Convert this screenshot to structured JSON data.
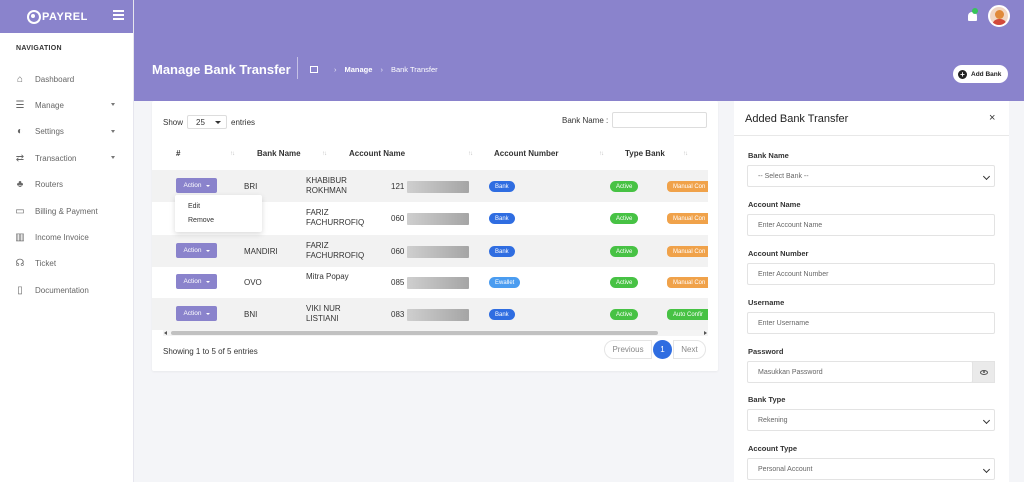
{
  "brand": {
    "name": "PAYREL"
  },
  "sidebar": {
    "title": "NAVIGATION",
    "items": [
      {
        "label": "Dashboard",
        "icon": "home-icon",
        "glyph": "⌂",
        "has_caret": false
      },
      {
        "label": "Manage",
        "icon": "list-icon",
        "glyph": "☰",
        "has_caret": true
      },
      {
        "label": "Settings",
        "icon": "toggle-icon",
        "glyph": "◐",
        "has_caret": true
      },
      {
        "label": "Transaction",
        "icon": "exchange-icon",
        "glyph": "⇄",
        "has_caret": true
      },
      {
        "label": "Routers",
        "icon": "sitemap-icon",
        "glyph": "♣",
        "has_caret": false
      },
      {
        "label": "Billing & Payment",
        "icon": "credit-card-icon",
        "glyph": "▭",
        "has_caret": false
      },
      {
        "label": "Income Invoice",
        "icon": "bar-chart-icon",
        "glyph": "▥",
        "has_caret": false
      },
      {
        "label": "Ticket",
        "icon": "headset-icon",
        "glyph": "☊",
        "has_caret": false
      },
      {
        "label": "Documentation",
        "icon": "document-icon",
        "glyph": "▯",
        "has_caret": false
      }
    ]
  },
  "header": {
    "page_title": "Manage Bank Transfer",
    "breadcrumb": [
      "Manage",
      "Bank Transfer"
    ],
    "add_button": "Add Bank"
  },
  "table": {
    "show_label": "Show",
    "entries_value": "25",
    "entries_label": "entries",
    "search_label": "Bank Name :",
    "columns": [
      "#",
      "Bank Name",
      "Account Name",
      "Account Number",
      "Type Bank"
    ],
    "action_label": "Action",
    "rows": [
      {
        "bank": "BRI",
        "name": "KHABIBUR ROKHMAN",
        "number": "121",
        "type": "Bank",
        "status": "Active",
        "mode": "Manual Con"
      },
      {
        "bank": "",
        "name": "FARIZ FACHURROFIQ",
        "number": "060",
        "type": "Bank",
        "status": "Active",
        "mode": "Manual Con"
      },
      {
        "bank": "MANDIRI",
        "name": "FARIZ FACHURROFIQ",
        "number": "060",
        "type": "Bank",
        "status": "Active",
        "mode": "Manual Con"
      },
      {
        "bank": "OVO",
        "name": "Mitra Popay",
        "number": "085",
        "type": "Ewallet",
        "status": "Active",
        "mode": "Manual Con"
      },
      {
        "bank": "BNI",
        "name": "VIKI NUR LISTIANI",
        "number": "083",
        "type": "Bank",
        "status": "Active",
        "mode": "Auto Confir"
      }
    ],
    "dropdown": [
      "Edit",
      "Remove"
    ],
    "footer": "Showing 1 to 5 of 5 entries",
    "pagination": {
      "prev": "Previous",
      "current": "1",
      "next": "Next"
    }
  },
  "panel": {
    "title": "Added Bank Transfer",
    "close": "×",
    "fields": [
      {
        "label": "Bank Name",
        "value": "-- Select Bank --",
        "kind": "select"
      },
      {
        "label": "Account Name",
        "placeholder": "Enter Account Name",
        "kind": "input"
      },
      {
        "label": "Account Number",
        "placeholder": "Enter Account Number",
        "kind": "input"
      },
      {
        "label": "Username",
        "placeholder": "Enter Username",
        "kind": "input"
      },
      {
        "label": "Password",
        "placeholder": "Masukkan Password",
        "kind": "password"
      },
      {
        "label": "Bank Type",
        "value": "Rekening",
        "kind": "select"
      },
      {
        "label": "Account Type",
        "value": "Personal Account",
        "kind": "select"
      }
    ]
  },
  "colors": {
    "accent": "#8a83cc",
    "primary": "#2f6de1",
    "success": "#47c244",
    "warning": "#f0a24a"
  }
}
